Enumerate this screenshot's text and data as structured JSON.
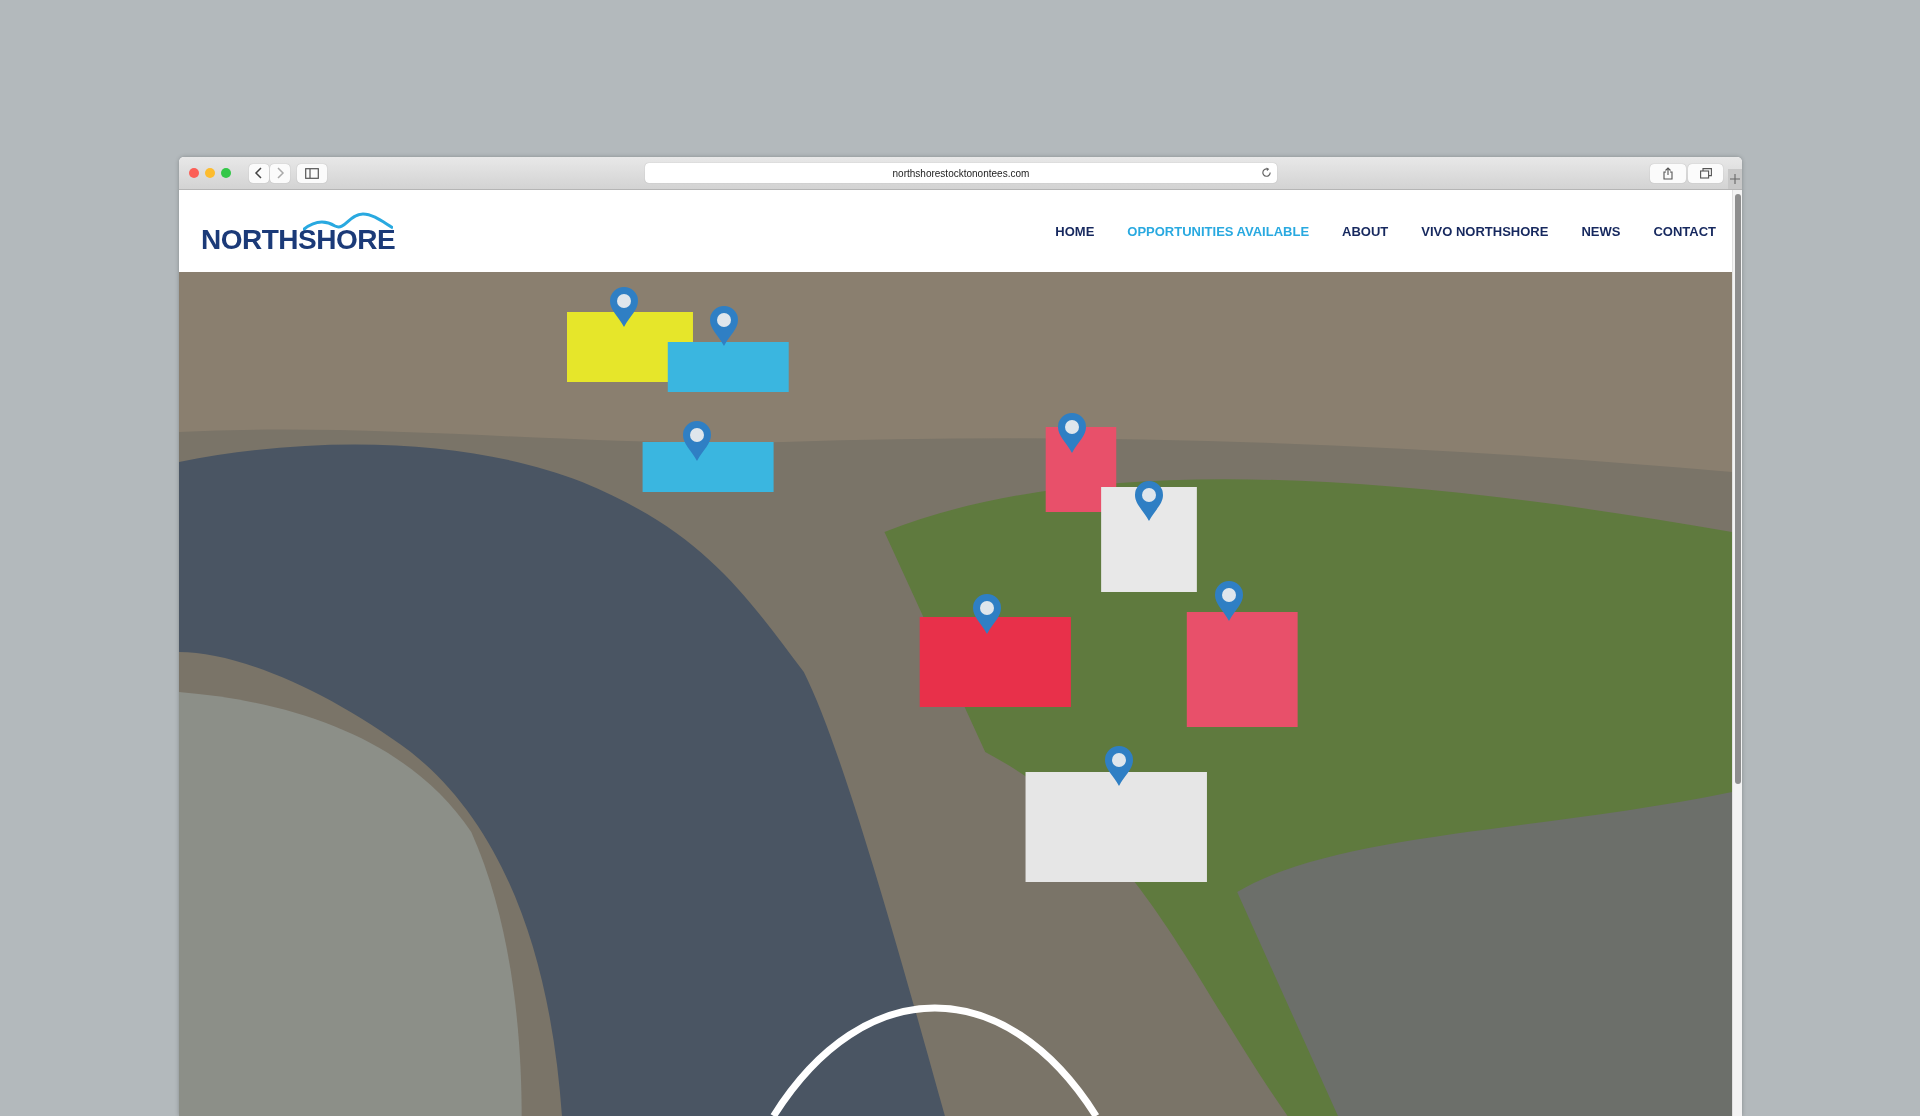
{
  "browser": {
    "url": "northshorestocktonontees.com"
  },
  "site": {
    "logo": "NORTHSHORE",
    "nav": [
      {
        "label": "HOME",
        "selected": false
      },
      {
        "label": "OPPORTUNITIES AVAILABLE",
        "selected": true
      },
      {
        "label": "ABOUT",
        "selected": false
      },
      {
        "label": "VIVO NORTHSHORE",
        "selected": false
      },
      {
        "label": "NEWS",
        "selected": false
      },
      {
        "label": "CONTACT",
        "selected": false
      }
    ]
  }
}
